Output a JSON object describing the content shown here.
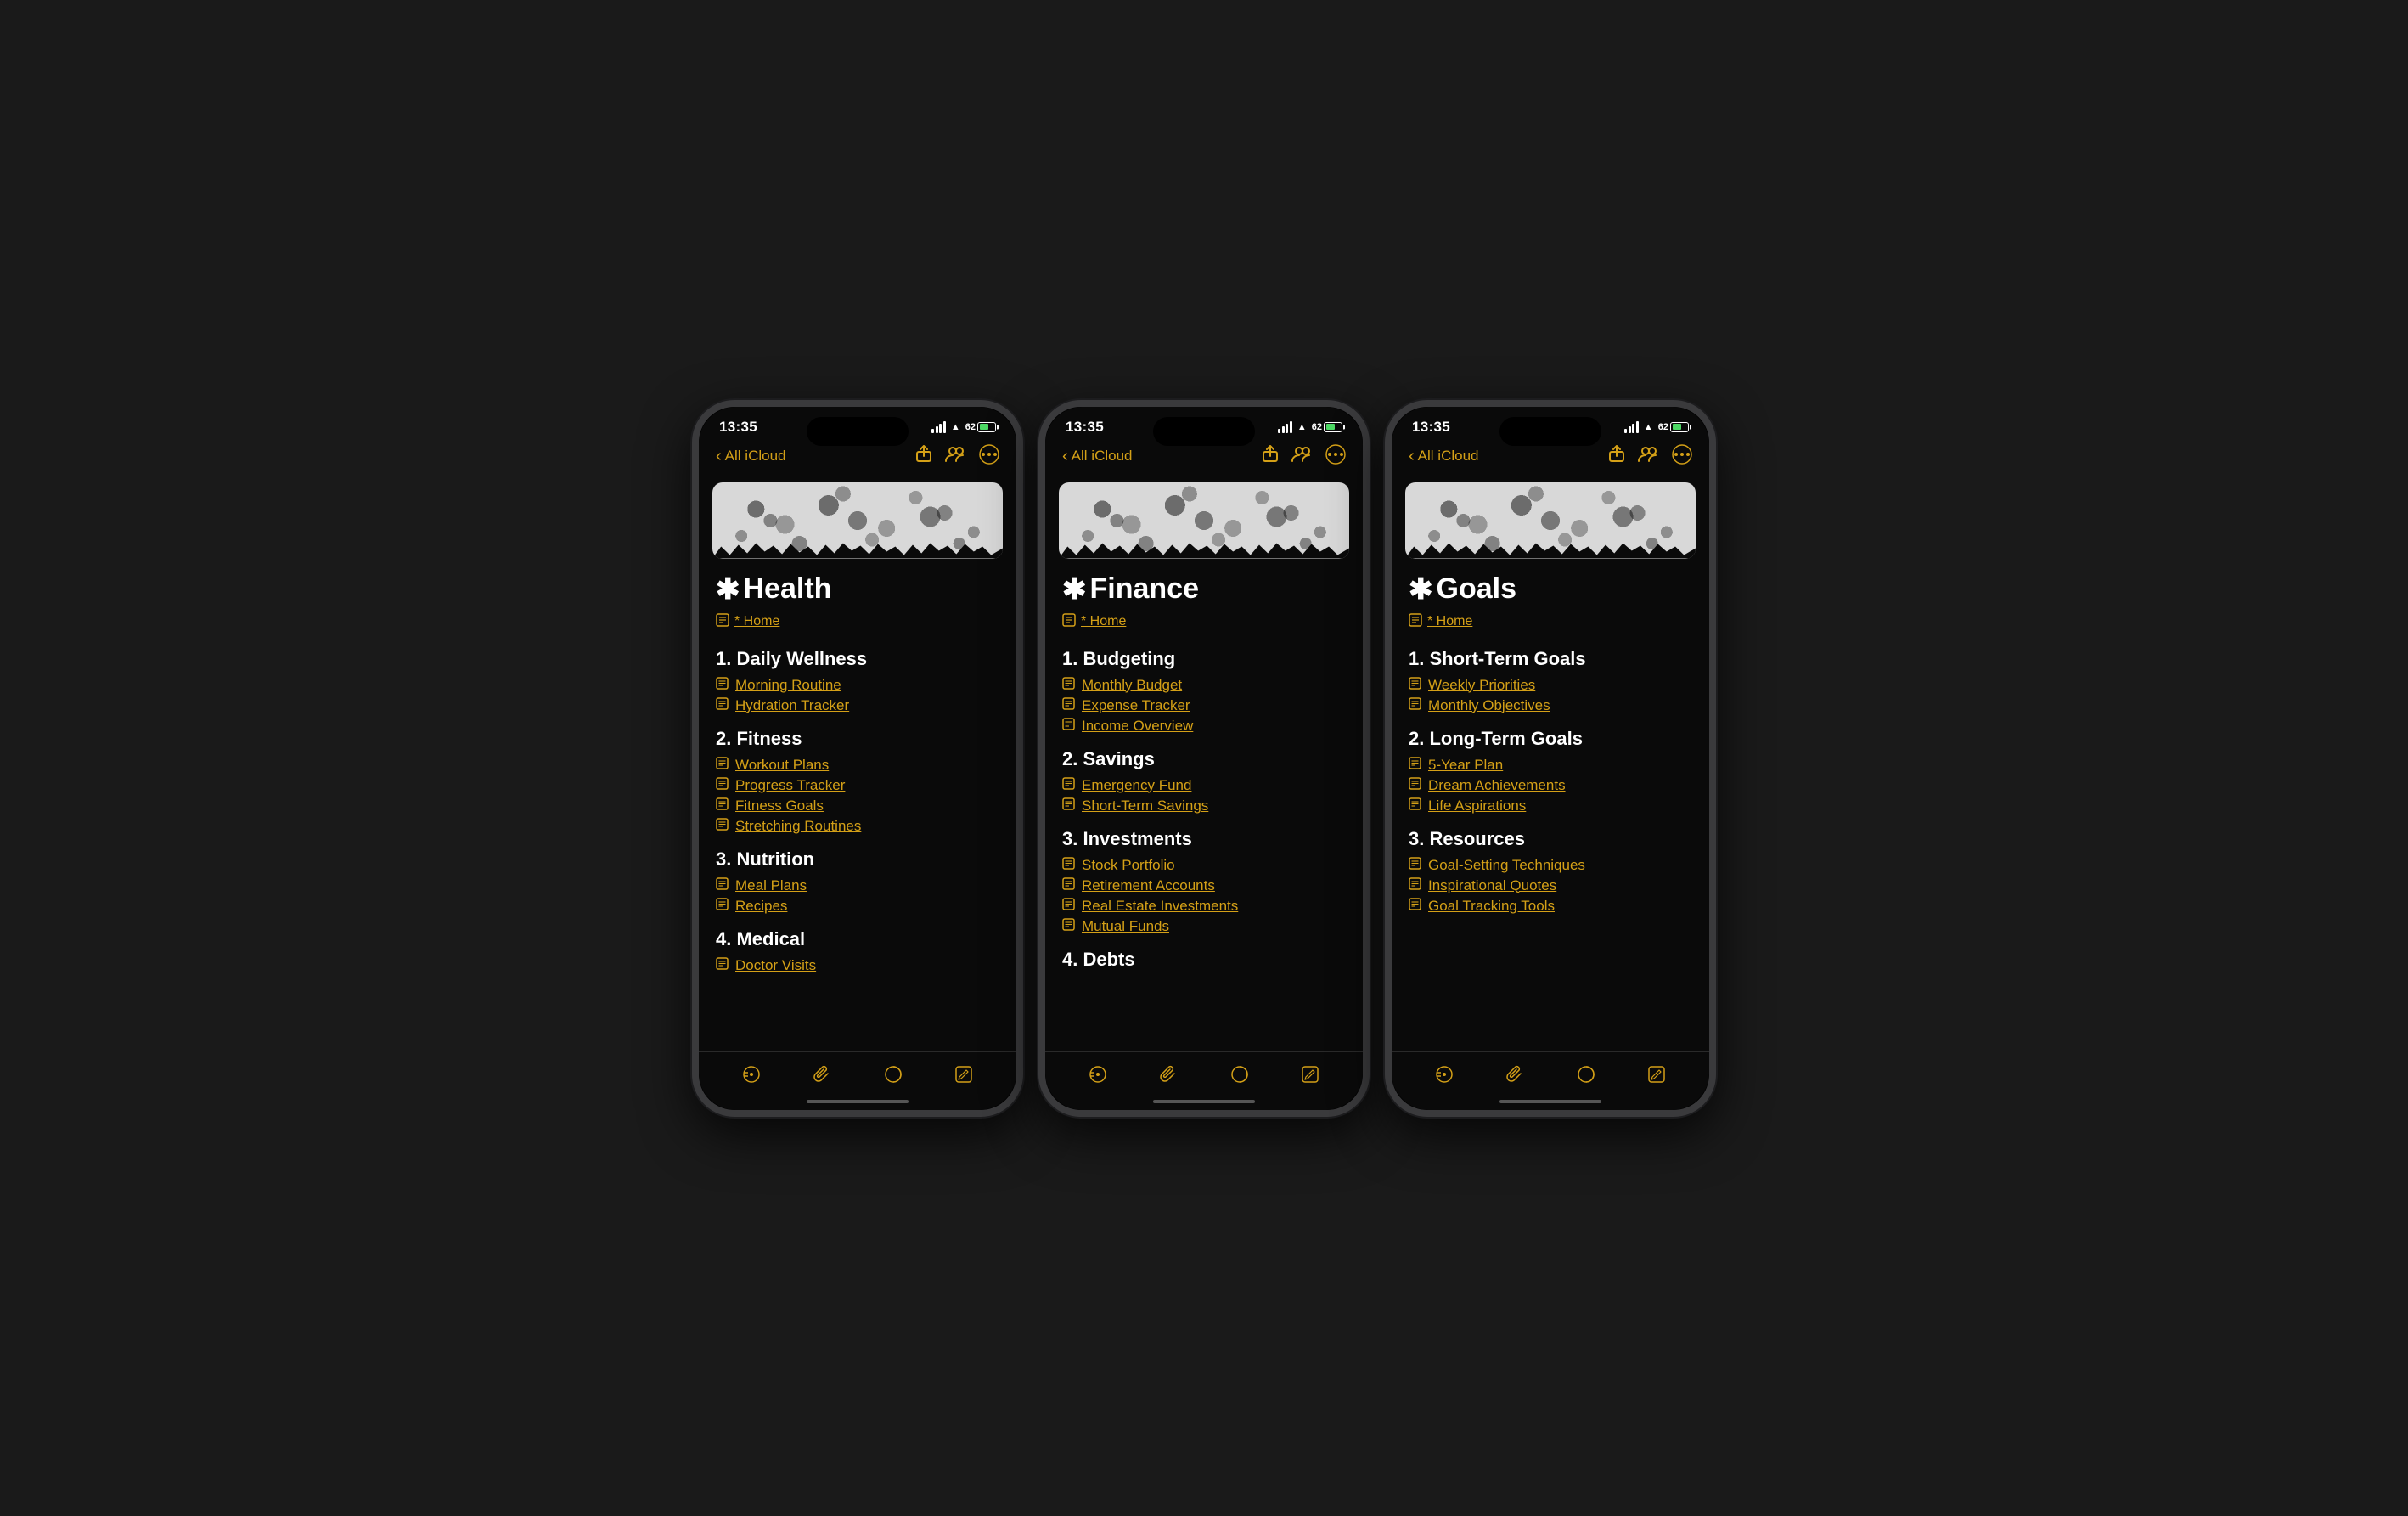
{
  "phones": [
    {
      "id": "health",
      "status": {
        "time": "13:35",
        "battery": "62"
      },
      "nav": {
        "back_label": "All iCloud"
      },
      "main_title": "Health",
      "home_link": "* Home",
      "sections": [
        {
          "title": "1. Daily Wellness",
          "items": [
            "Morning Routine",
            "Hydration Tracker"
          ]
        },
        {
          "title": "2. Fitness",
          "items": [
            "Workout Plans",
            "Progress Tracker",
            "Fitness Goals",
            "Stretching Routines"
          ]
        },
        {
          "title": "3. Nutrition",
          "items": [
            "Meal Plans",
            "Recipes"
          ]
        },
        {
          "title": "4. Medical",
          "items": [
            "Doctor Visits"
          ]
        }
      ]
    },
    {
      "id": "finance",
      "status": {
        "time": "13:35",
        "battery": "62"
      },
      "nav": {
        "back_label": "All iCloud"
      },
      "main_title": "Finance",
      "home_link": "* Home",
      "sections": [
        {
          "title": "1. Budgeting",
          "items": [
            "Monthly Budget",
            "Expense Tracker",
            "Income Overview"
          ]
        },
        {
          "title": "2. Savings",
          "items": [
            "Emergency Fund",
            "Short-Term Savings"
          ]
        },
        {
          "title": "3. Investments",
          "items": [
            "Stock Portfolio",
            "Retirement Accounts",
            "Real Estate Investments",
            "Mutual Funds"
          ]
        },
        {
          "title": "4. Debts",
          "items": []
        }
      ]
    },
    {
      "id": "goals",
      "status": {
        "time": "13:35",
        "battery": "62"
      },
      "nav": {
        "back_label": "All iCloud"
      },
      "main_title": "Goals",
      "home_link": "* Home",
      "sections": [
        {
          "title": "1. Short-Term Goals",
          "items": [
            "Weekly Priorities",
            "Monthly Objectives"
          ]
        },
        {
          "title": "2. Long-Term Goals",
          "items": [
            "5-Year Plan",
            "Dream Achievements",
            "Life Aspirations"
          ]
        },
        {
          "title": "3. Resources",
          "items": [
            "Goal-Setting Techniques",
            "Inspirational Quotes",
            "Goal Tracking Tools"
          ]
        }
      ]
    }
  ],
  "icons": {
    "back_arrow": "‹",
    "share": "⬆",
    "people": "⊕",
    "more": "···",
    "note": "▤",
    "asterisk": "∗",
    "tab_list": "⊙≡",
    "tab_attach": "⌀",
    "tab_compose": "⊘",
    "tab_edit": "⬜"
  }
}
